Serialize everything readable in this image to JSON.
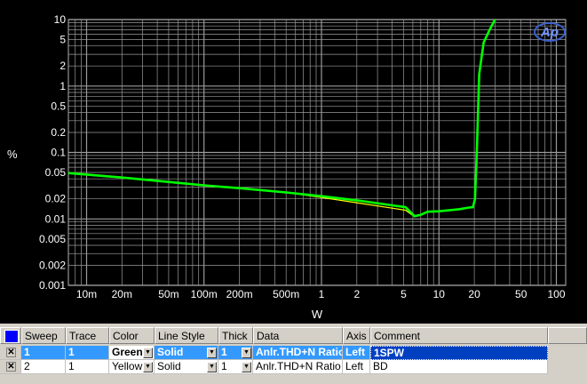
{
  "chart_data": {
    "type": "line",
    "xlabel": "W",
    "ylabel": "%",
    "xscale": "log",
    "yscale": "log",
    "xlim": [
      0.007,
      120
    ],
    "ylim": [
      0.001,
      10
    ],
    "x_ticks": [
      "10m",
      "20m",
      "50m",
      "100m",
      "200m",
      "500m",
      "1",
      "2",
      "5",
      "10",
      "20",
      "50",
      "100"
    ],
    "x_tick_values": [
      0.01,
      0.02,
      0.05,
      0.1,
      0.2,
      0.5,
      1,
      2,
      5,
      10,
      20,
      50,
      100
    ],
    "y_ticks": [
      "10",
      "5",
      "2",
      "1",
      "0.5",
      "0.2",
      "0.1",
      "0.05",
      "0.02",
      "0.01",
      "0.005",
      "0.002",
      "0.001"
    ],
    "y_tick_values": [
      10,
      5,
      2,
      1,
      0.5,
      0.2,
      0.1,
      0.05,
      0.02,
      0.01,
      0.005,
      0.002,
      0.001
    ],
    "grid": true,
    "legend": "none",
    "series": [
      {
        "color": "#00ff00",
        "x": [
          0.007,
          0.02,
          0.05,
          0.1,
          0.2,
          0.5,
          1,
          2,
          4,
          5.2,
          6.2,
          7,
          8,
          10,
          15,
          18,
          19.5,
          20.3,
          21,
          22,
          24,
          27,
          30
        ],
        "y": [
          0.049,
          0.042,
          0.036,
          0.032,
          0.029,
          0.025,
          0.022,
          0.019,
          0.016,
          0.015,
          0.011,
          0.0115,
          0.0128,
          0.013,
          0.014,
          0.0148,
          0.015,
          0.02,
          0.1,
          1.5,
          4.5,
          7,
          10
        ]
      },
      {
        "color": "#ffff00",
        "x": [
          0.007,
          0.02,
          0.05,
          0.1,
          0.2,
          0.5,
          1,
          2,
          4,
          5.2,
          6.2,
          7,
          8,
          10,
          15,
          18,
          19.5,
          20.3,
          21,
          22,
          24,
          27,
          30
        ],
        "y": [
          0.049,
          0.042,
          0.036,
          0.032,
          0.029,
          0.025,
          0.021,
          0.0175,
          0.0145,
          0.0135,
          0.0108,
          0.0115,
          0.0128,
          0.013,
          0.014,
          0.0148,
          0.015,
          0.02,
          0.1,
          1.5,
          4.5,
          7,
          10
        ]
      }
    ]
  },
  "logo": "Ap",
  "sweep_table": {
    "headers": [
      "Sweep",
      "Trace",
      "Color",
      "Line Style",
      "Thick",
      "Data",
      "Axis",
      "Comment"
    ],
    "rows": [
      {
        "checked": true,
        "sweep": "1",
        "trace": "1",
        "color": "Green",
        "line_style": "Solid",
        "thick": "1",
        "data": "Anlr.THD+N Ratio",
        "axis": "Left",
        "comment": "1SPW",
        "selected": true
      },
      {
        "checked": true,
        "sweep": "2",
        "trace": "1",
        "color": "Yellow",
        "line_style": "Solid",
        "thick": "1",
        "data": "Anlr.THD+N Ratio",
        "axis": "Left",
        "comment": "BD",
        "selected": false
      }
    ]
  }
}
